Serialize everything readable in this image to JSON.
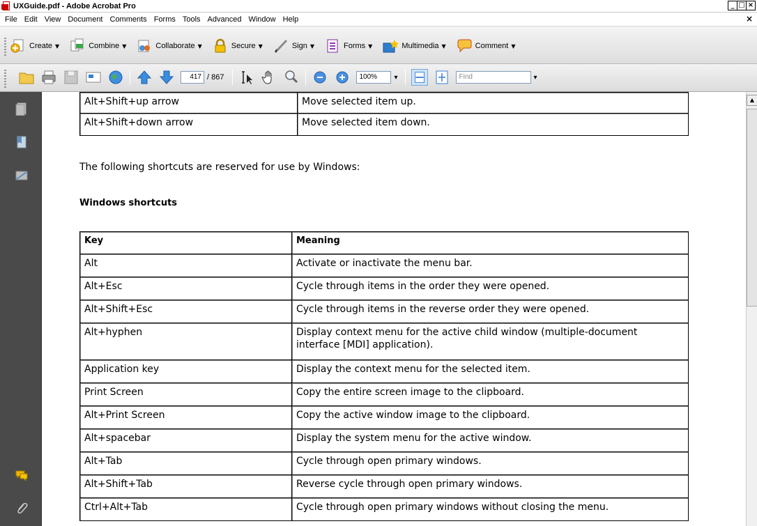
{
  "window": {
    "title": "UXGuide.pdf - Adobe Acrobat Pro",
    "controls": [
      "_",
      "□",
      "×"
    ]
  },
  "menubar": {
    "items": [
      "File",
      "Edit",
      "View",
      "Document",
      "Comments",
      "Forms",
      "Tools",
      "Advanced",
      "Window",
      "Help"
    ],
    "close": "×"
  },
  "tasks": {
    "items": [
      {
        "label": "Create",
        "icon": "create-icon"
      },
      {
        "label": "Combine",
        "icon": "combine-icon"
      },
      {
        "label": "Collaborate",
        "icon": "collaborate-icon"
      },
      {
        "label": "Secure",
        "icon": "lock-icon"
      },
      {
        "label": "Sign",
        "icon": "pen-icon"
      },
      {
        "label": "Forms",
        "icon": "forms-icon"
      },
      {
        "label": "Multimedia",
        "icon": "multimedia-icon"
      },
      {
        "label": "Comment",
        "icon": "comment-icon"
      }
    ],
    "caret": "▼"
  },
  "toolbar": {
    "page_current": "417",
    "page_total": "/ 867",
    "zoom": "100%",
    "find_placeholder": "Find",
    "caret": "▾"
  },
  "document": {
    "top_table": [
      {
        "key": "Alt+Shift+up arrow",
        "meaning": "Move selected item up."
      },
      {
        "key": "Alt+Shift+down arrow",
        "meaning": "Move selected item down."
      }
    ],
    "intro": "The following shortcuts are reserved for use by Windows:",
    "heading": "Windows shortcuts",
    "table_headers": {
      "key": "Key",
      "meaning": "Meaning"
    },
    "rows": [
      {
        "key": "Alt",
        "meaning": "Activate or inactivate the menu bar."
      },
      {
        "key": "Alt+Esc",
        "meaning": "Cycle through items in the order they were opened."
      },
      {
        "key": "Alt+Shift+Esc",
        "meaning": "Cycle through items in the reverse order they were opened."
      },
      {
        "key": "Alt+hyphen",
        "meaning": "Display context menu for the active child window (multiple-document interface [MDI] application)."
      },
      {
        "key": "Application key",
        "meaning": "Display the context menu for the selected item."
      },
      {
        "key": "Print Screen",
        "meaning": "Copy the entire screen image to the clipboard."
      },
      {
        "key": "Alt+Print Screen",
        "meaning": "Copy the active window image to the clipboard."
      },
      {
        "key": "Alt+spacebar",
        "meaning": "Display the system menu for the active window."
      },
      {
        "key": "Alt+Tab",
        "meaning": "Cycle through open primary windows."
      },
      {
        "key": "Alt+Shift+Tab",
        "meaning": "Reverse cycle through open primary windows."
      },
      {
        "key": "Ctrl+Alt+Tab",
        "meaning": "Cycle through open primary windows without closing the menu."
      }
    ]
  },
  "colors": {
    "nav_bg": "#4a4a4a",
    "accent_blue": "#1e73d8",
    "acrobat_red": "#cc0000"
  }
}
